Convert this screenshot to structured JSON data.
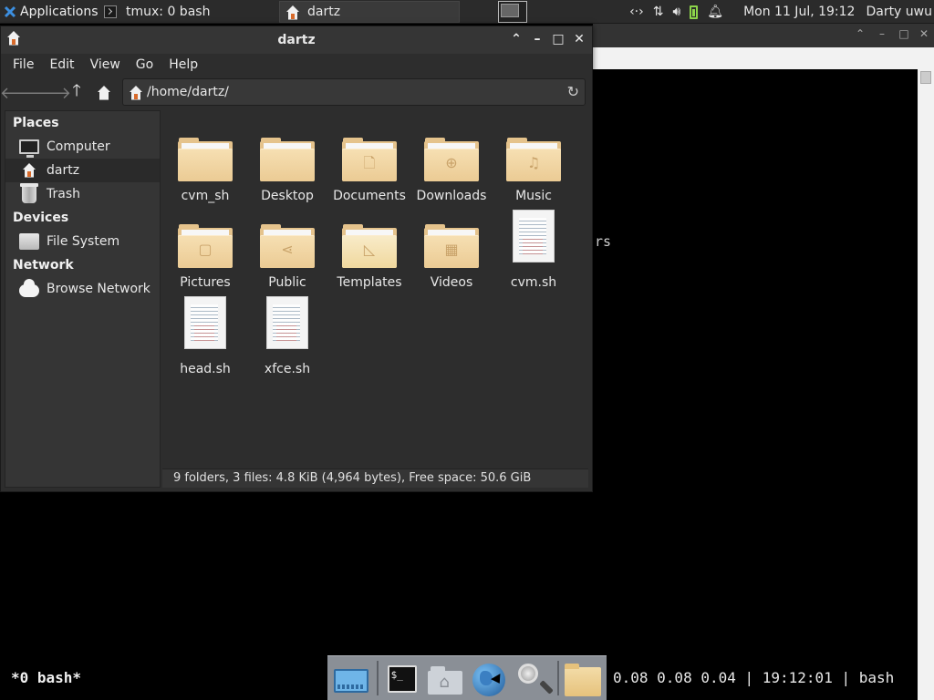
{
  "top_panel": {
    "applications_label": "Applications",
    "tasks": [
      {
        "label": "tmux: 0 bash"
      },
      {
        "label": "dartz"
      }
    ],
    "clock": "Mon 11 Jul, 19:12",
    "user": "Darty uwu",
    "icons": [
      "network-icon",
      "updown-icon",
      "volume-icon",
      "battery-icon",
      "bell-icon"
    ]
  },
  "terminal": {
    "fragment": "rs",
    "tmux_left": "*0 bash*",
    "tmux_right": "0.08 0.08 0.04 | 19:12:01 | bash"
  },
  "dock": {
    "items": [
      "desktop-icon",
      "terminal-icon",
      "home-folder-icon",
      "web-browser-icon",
      "search-icon",
      "file-manager-icon"
    ],
    "term_glyph": "$_"
  },
  "file_manager": {
    "title": "dartz",
    "menu": [
      "File",
      "Edit",
      "View",
      "Go",
      "Help"
    ],
    "location": "/home/dartz/",
    "sidebar": {
      "places_title": "Places",
      "places": [
        {
          "label": "Computer",
          "icon": "computer-icon"
        },
        {
          "label": "dartz",
          "icon": "home-icon"
        },
        {
          "label": "Trash",
          "icon": "trash-icon"
        }
      ],
      "devices_title": "Devices",
      "devices": [
        {
          "label": "File System",
          "icon": "drive-icon"
        }
      ],
      "network_title": "Network",
      "network": [
        {
          "label": "Browse Network",
          "icon": "cloud-icon"
        }
      ]
    },
    "files": [
      {
        "name": "cvm_sh",
        "type": "folder",
        "emblem": ""
      },
      {
        "name": "Desktop",
        "type": "folder",
        "emblem": ""
      },
      {
        "name": "Documents",
        "type": "folder",
        "emblem": "🗋"
      },
      {
        "name": "Downloads",
        "type": "folder",
        "emblem": "⊕"
      },
      {
        "name": "Music",
        "type": "folder",
        "emblem": "♫"
      },
      {
        "name": "Pictures",
        "type": "folder",
        "emblem": "▢"
      },
      {
        "name": "Public",
        "type": "folder",
        "emblem": "⋖"
      },
      {
        "name": "Templates",
        "type": "folder",
        "emblem": "◺"
      },
      {
        "name": "Videos",
        "type": "folder",
        "emblem": "▦"
      },
      {
        "name": "cvm.sh",
        "type": "script"
      },
      {
        "name": "head.sh",
        "type": "script"
      },
      {
        "name": "xfce.sh",
        "type": "script"
      }
    ],
    "status": "9 folders, 3 files: 4.8 KiB (4,964 bytes), Free space: 50.6 GiB"
  }
}
